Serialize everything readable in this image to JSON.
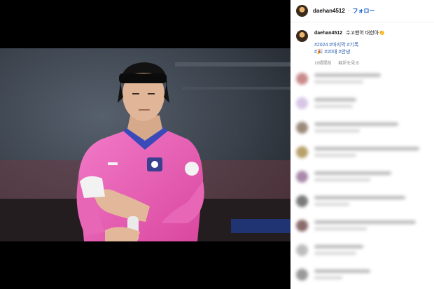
{
  "post": {
    "username": "daehan4512",
    "separator": "·",
    "follow_label": "フォロー",
    "caption": "수고했어 대한아👏",
    "hashtags_line1": "#2024 #마지막 #기록",
    "hashtags_line2": "#🎉 #20대 #안녕",
    "time_ago": "18週間前",
    "translate_label": "翻訳を見る"
  },
  "comments": [
    {
      "color": "#c98a8a"
    },
    {
      "color": "#d7c6e6"
    },
    {
      "color": "#9b8a7a"
    },
    {
      "color": "#b7a06a"
    },
    {
      "color": "#a989a9"
    },
    {
      "color": "#7a7a7a"
    },
    {
      "color": "#8a6a6a"
    },
    {
      "color": "#bdbdbd"
    },
    {
      "color": "#999999"
    }
  ]
}
